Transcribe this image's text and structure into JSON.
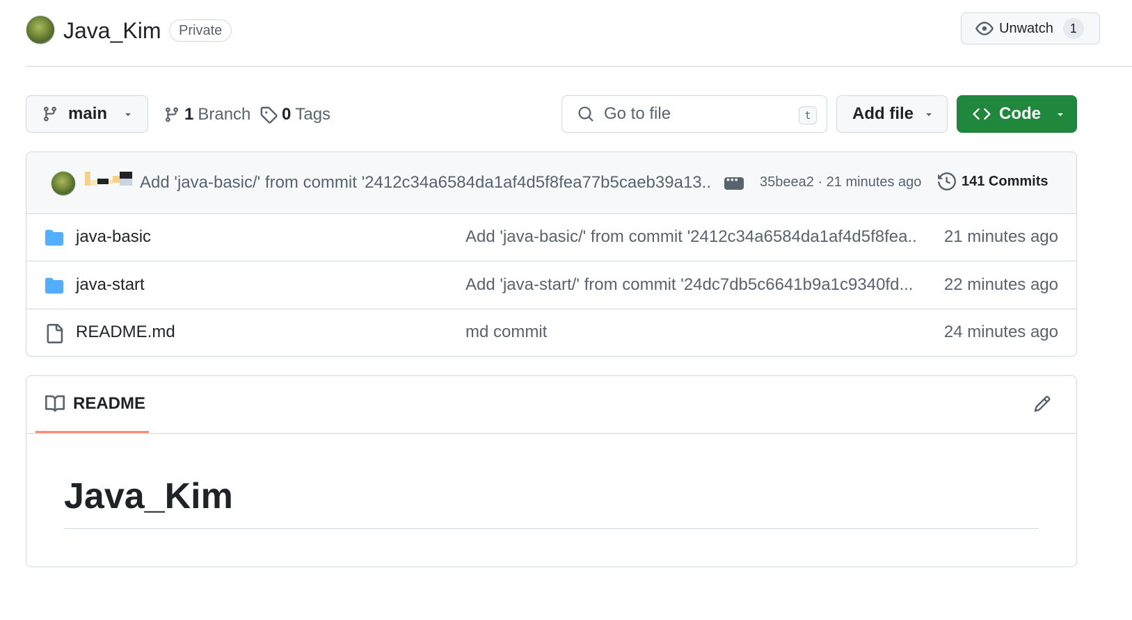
{
  "repo": {
    "name": "Java_Kim",
    "visibility": "Private",
    "unwatch_label": "Unwatch",
    "watch_count": "1"
  },
  "toolbar": {
    "branch_name": "main",
    "branch_count": "1",
    "branch_label": "Branch",
    "tag_count": "0",
    "tag_label": "Tags",
    "search_placeholder": "Go to file",
    "search_shortcut": "t",
    "add_file_label": "Add file",
    "code_label": "Code"
  },
  "latest_commit": {
    "message": "Add 'java-basic/' from commit '2412c34a6584da1af4d5f8fea77b5caeb39a13...",
    "sha": "35beea2",
    "separator": "·",
    "time": "21 minutes ago",
    "commits_count_label": "141 Commits"
  },
  "files": [
    {
      "type": "folder",
      "name": "java-basic",
      "commit": "Add 'java-basic/' from commit '2412c34a6584da1af4d5f8fea...",
      "time": "21 minutes ago"
    },
    {
      "type": "folder",
      "name": "java-start",
      "commit": "Add 'java-start/' from commit '24dc7db5c6641b9a1c9340fd...",
      "time": "22 minutes ago"
    },
    {
      "type": "file",
      "name": "README.md",
      "commit": "md commit",
      "time": "24 minutes ago"
    }
  ],
  "readme": {
    "tab_label": "README",
    "heading": "Java_Kim"
  },
  "colors": {
    "primary_green": "#1f883d",
    "folder_blue": "#54aeff",
    "tab_underline": "#fd8c73",
    "muted_text": "#59636e",
    "border": "#d1d9e0"
  },
  "icons": [
    "eye-icon",
    "git-branch-icon",
    "tag-icon",
    "search-icon",
    "caret-down-icon",
    "code-icon",
    "history-icon",
    "folder-icon",
    "file-icon",
    "book-icon",
    "pencil-icon",
    "kebab-horizontal-icon"
  ]
}
